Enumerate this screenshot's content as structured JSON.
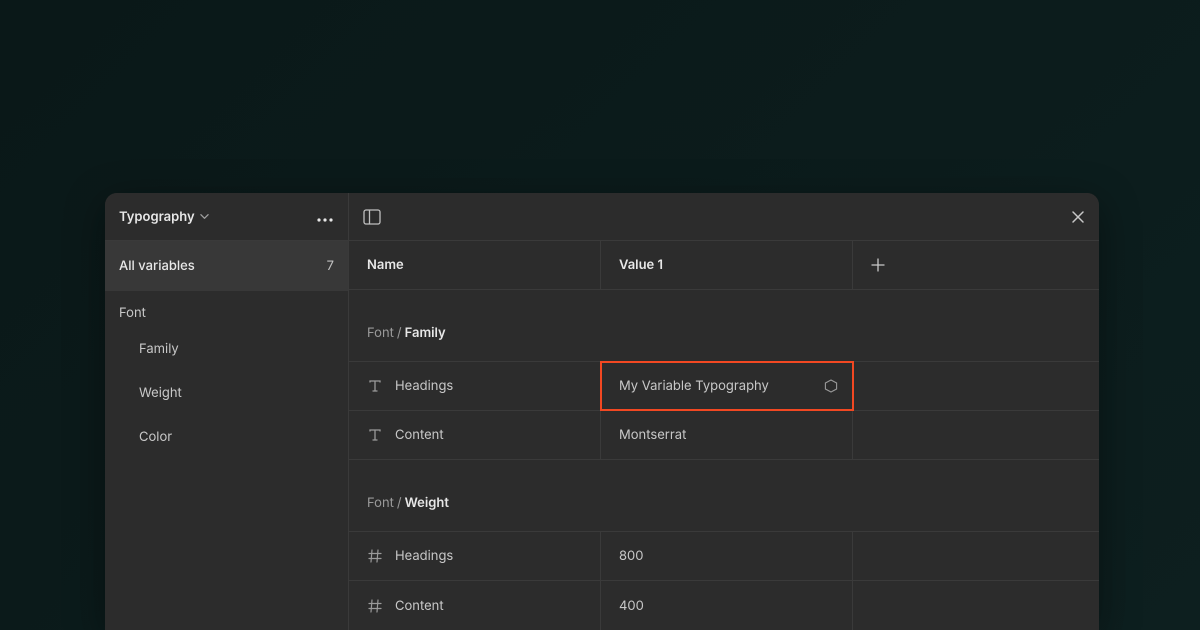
{
  "collection": {
    "name": "Typography"
  },
  "sidebar": {
    "all_variables_label": "All variables",
    "all_variables_count": "7",
    "group_label": "Font",
    "items": [
      {
        "label": "Family"
      },
      {
        "label": "Weight"
      },
      {
        "label": "Color"
      }
    ]
  },
  "table": {
    "headers": {
      "name": "Name",
      "value1": "Value 1"
    },
    "groups": [
      {
        "prefix": "Font",
        "name": "Family",
        "rows": [
          {
            "icon": "text",
            "name": "Headings",
            "value": "My Variable Typography",
            "highlighted": true,
            "has_alias_icon": true
          },
          {
            "icon": "text",
            "name": "Content",
            "value": "Montserrat",
            "highlighted": false,
            "has_alias_icon": false
          }
        ]
      },
      {
        "prefix": "Font",
        "name": "Weight",
        "rows": [
          {
            "icon": "number",
            "name": "Headings",
            "value": "800",
            "highlighted": false,
            "has_alias_icon": false
          },
          {
            "icon": "number",
            "name": "Content",
            "value": "400",
            "highlighted": false,
            "has_alias_icon": false
          }
        ]
      }
    ]
  }
}
